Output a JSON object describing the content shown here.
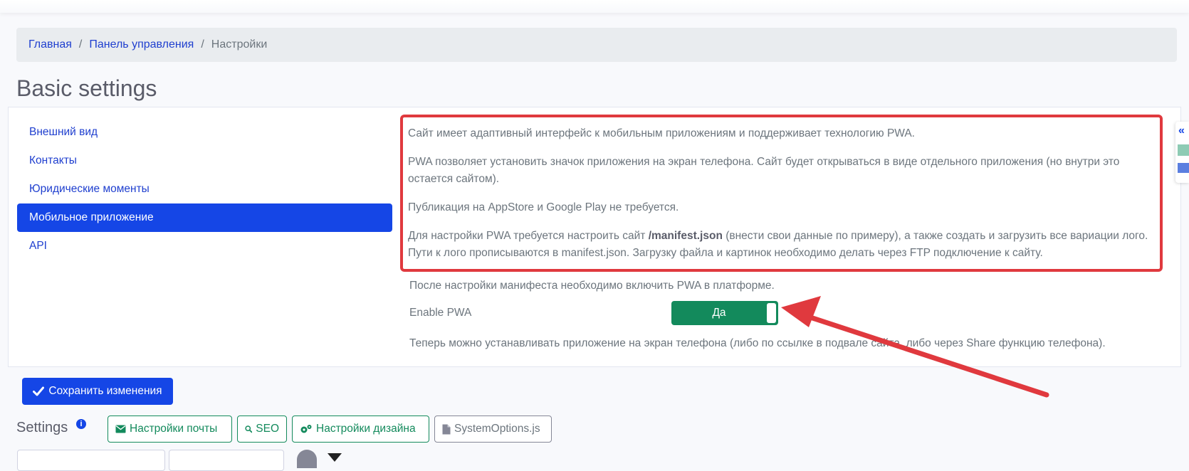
{
  "breadcrumb": {
    "items": [
      "Главная",
      "Панель управления"
    ],
    "current": "Настройки",
    "separator": "/"
  },
  "page": {
    "title": "Basic settings"
  },
  "nav": {
    "items": [
      {
        "label": "Внешний вид",
        "active": false
      },
      {
        "label": "Контакты",
        "active": false
      },
      {
        "label": "Юридические моменты",
        "active": false
      },
      {
        "label": "Мобильное приложение",
        "active": true
      },
      {
        "label": "API",
        "active": false
      }
    ]
  },
  "content": {
    "p1": "Сайт имеет адаптивный интерфейс к мобильным приложениям и поддерживает технологию PWA.",
    "p2": "PWA позволяет установить значок приложения на экран телефона. Сайт будет открываться в виде отдельного приложения (но внутри это остается сайтом).",
    "p3": "Публикация на AppStore и Google Play не требуется.",
    "p4_before": "Для настройки PWA требуется настроить сайт ",
    "p4_bold": "/manifest.json",
    "p4_after": " (внести свои данные по примеру), а также создать и загрузить все вариации лого. Пути к лого прописываются в manifest.json. Загрузку файла и картинок необходимо делать через FTP подключение к сайту.",
    "after_manifest": "После настройки манифеста необходимо включить PWA в платформе.",
    "enable_label": "Enable PWA",
    "toggle_label": "Да",
    "final_note": "Теперь можно устанавливать приложение на экран телефона (либо по ссылке в подвале сайта, либо через Share функцию телефона)."
  },
  "actions": {
    "save_label": "Сохранить изменения"
  },
  "settings": {
    "label": "Settings",
    "info_glyph": "i",
    "buttons": [
      {
        "label": "Настройки почты",
        "icon": "envelope-icon"
      },
      {
        "label": "SEO",
        "icon": "search-icon"
      },
      {
        "label": "Настройки дизайна",
        "icon": "gears-icon"
      },
      {
        "label": "SystemOptions.js",
        "icon": "file-icon"
      }
    ]
  },
  "side_widget": {
    "glyph": "«"
  },
  "colors": {
    "primary": "#1546e6",
    "success": "#138a5c",
    "highlight": "#e0393e",
    "link": "#1f3fcf"
  }
}
